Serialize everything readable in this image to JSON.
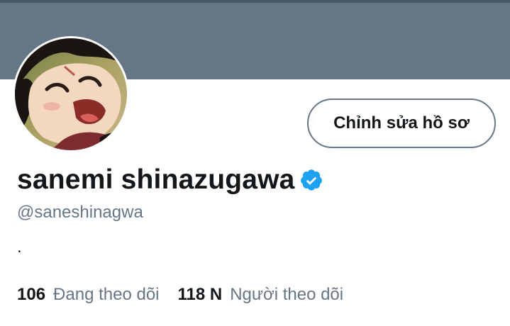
{
  "profile": {
    "display_name": "sanemi shinazugawa",
    "handle": "@saneshinagwa",
    "bio": ".",
    "verified": true,
    "verified_icon": "verified-badge-icon",
    "avatar_icon": "profile-avatar"
  },
  "actions": {
    "edit_profile_label": "Chỉnh sửa hồ sơ"
  },
  "stats": {
    "following_count": "106",
    "following_label": "Đang theo dõi",
    "followers_count": "118 N",
    "followers_label": "Người theo dõi"
  },
  "colors": {
    "banner": "#657786",
    "accent": "#1da1f2",
    "text_primary": "#14171a",
    "text_secondary": "#657786"
  }
}
